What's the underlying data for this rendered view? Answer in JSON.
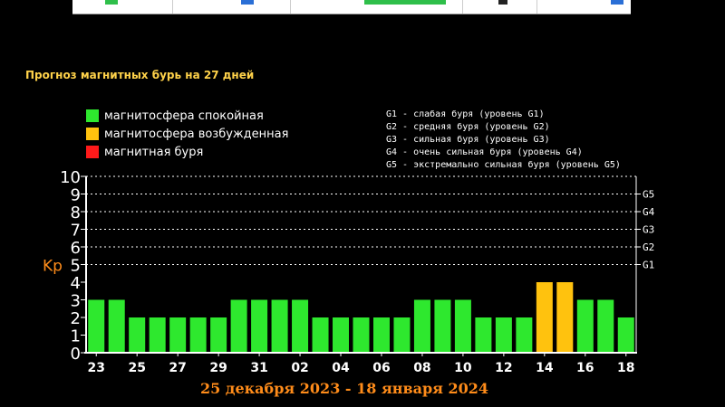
{
  "title": "Прогноз магнитных бурь на 27 дней",
  "legend": [
    {
      "label": "магнитосфера спокойная",
      "color": "#2ee82e"
    },
    {
      "label": "магнитосфера возбужденная",
      "color": "#ffc20e"
    },
    {
      "label": "магнитная буря",
      "color": "#ff1a1a"
    }
  ],
  "storm_levels": [
    "G1 - слабая буря (уровень G1)",
    "G2 - средняя буря (уровень G2)",
    "G3 - сильная буря (уровень G3)",
    "G4 - очень сильная буря (уровень G4)",
    "G5 - экстремально сильная буря (уровень G5)"
  ],
  "date_range": "25 декабря 2023 - 18 января 2024",
  "chart_data": {
    "type": "bar",
    "ylabel": "Kp",
    "ylim": [
      0,
      10
    ],
    "yticks": [
      "0",
      "1",
      "2",
      "3",
      "4",
      "5",
      "6",
      "7",
      "8",
      "9",
      "10"
    ],
    "right_ticks": [
      {
        "value": 5,
        "label": "G1"
      },
      {
        "value": 6,
        "label": "G2"
      },
      {
        "value": 7,
        "label": "G3"
      },
      {
        "value": 8,
        "label": "G4"
      },
      {
        "value": 9,
        "label": "G5"
      }
    ],
    "grid": true,
    "values": [
      3,
      3,
      2,
      2,
      2,
      2,
      2,
      3,
      3,
      3,
      3,
      2,
      2,
      2,
      2,
      2,
      3,
      3,
      3,
      2,
      2,
      2,
      4,
      4,
      3,
      3,
      2
    ],
    "colors": [
      "#2ee82e",
      "#2ee82e",
      "#2ee82e",
      "#2ee82e",
      "#2ee82e",
      "#2ee82e",
      "#2ee82e",
      "#2ee82e",
      "#2ee82e",
      "#2ee82e",
      "#2ee82e",
      "#2ee82e",
      "#2ee82e",
      "#2ee82e",
      "#2ee82e",
      "#2ee82e",
      "#2ee82e",
      "#2ee82e",
      "#2ee82e",
      "#2ee82e",
      "#2ee82e",
      "#2ee82e",
      "#ffc20e",
      "#ffc20e",
      "#2ee82e",
      "#2ee82e",
      "#2ee82e"
    ],
    "xlabels": [
      {
        "index": 0,
        "label": "23"
      },
      {
        "index": 2,
        "label": "25"
      },
      {
        "index": 4,
        "label": "27"
      },
      {
        "index": 6,
        "label": "29"
      },
      {
        "index": 8,
        "label": "31"
      },
      {
        "index": 10,
        "label": "02"
      },
      {
        "index": 12,
        "label": "04"
      },
      {
        "index": 14,
        "label": "06"
      },
      {
        "index": 16,
        "label": "08"
      },
      {
        "index": 18,
        "label": "10"
      },
      {
        "index": 20,
        "label": "12"
      },
      {
        "index": 22,
        "label": "14"
      },
      {
        "index": 24,
        "label": "16"
      },
      {
        "index": 26,
        "label": "18"
      }
    ]
  },
  "colors": {
    "background": "#000000",
    "title": "#ffd24a",
    "axis_text": "#ffffff",
    "kp_label": "#ff8c1a",
    "date_range": "#ff8c1a"
  }
}
